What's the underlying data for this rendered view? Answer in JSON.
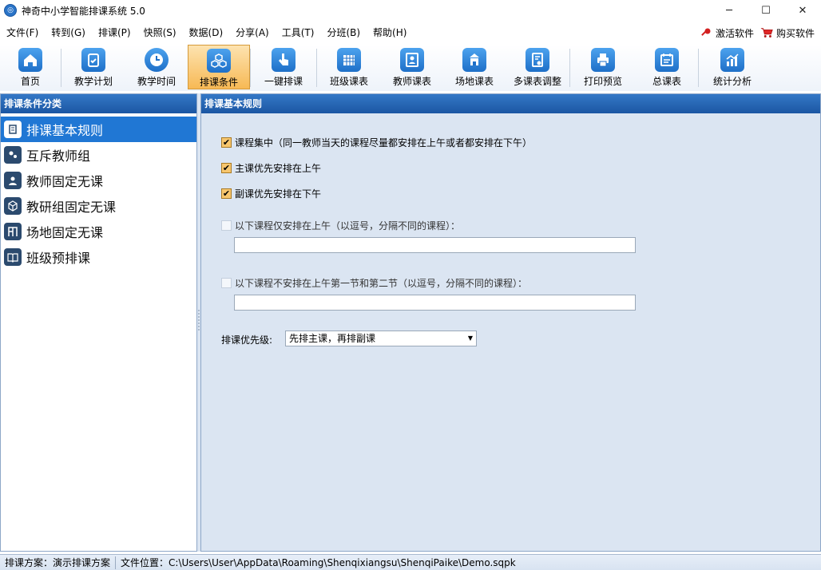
{
  "window": {
    "title": "神奇中小学智能排课系统 5.0"
  },
  "menu": [
    "文件(F)",
    "转到(G)",
    "排课(P)",
    "快照(S)",
    "数据(D)",
    "分享(A)",
    "工具(T)",
    "分班(B)",
    "帮助(H)"
  ],
  "menu_right": {
    "activate": "激活软件",
    "buy": "购买软件"
  },
  "toolbar": [
    "首页",
    "教学计划",
    "教学时间",
    "排课条件",
    "一键排课",
    "班级课表",
    "教师课表",
    "场地课表",
    "多课表调整",
    "打印预览",
    "总课表",
    "统计分析"
  ],
  "toolbar_active": "排课条件",
  "left_panel": {
    "title": "排课条件分类",
    "items": [
      "排课基本规则",
      "互斥教师组",
      "教师固定无课",
      "教研组固定无课",
      "场地固定无课",
      "班级预排课"
    ]
  },
  "right_panel": {
    "title": "排课基本规则",
    "options": [
      {
        "label": "课程集中（同一教师当天的课程尽量都安排在上午或者都安排在下午）",
        "checked": true
      },
      {
        "label": "主课优先安排在上午",
        "checked": true
      },
      {
        "label": "副课优先安排在下午",
        "checked": true
      }
    ],
    "morning_only": {
      "label": "以下课程仅安排在上午（以逗号，分隔不同的课程）：",
      "checked": false,
      "value": ""
    },
    "not_first_two": {
      "label": "以下课程不安排在上午第一节和第二节（以逗号，分隔不同的课程）：",
      "checked": false,
      "value": ""
    },
    "priority": {
      "label": "排课优先级:",
      "selected": "先排主课，再排副课"
    }
  },
  "status": {
    "plan": "排课方案：演示排课方案",
    "file": "文件位置：C:\\Users\\User\\AppData\\Roaming\\Shenqixiangsu\\ShenqiPaike\\Demo.sqpk"
  }
}
